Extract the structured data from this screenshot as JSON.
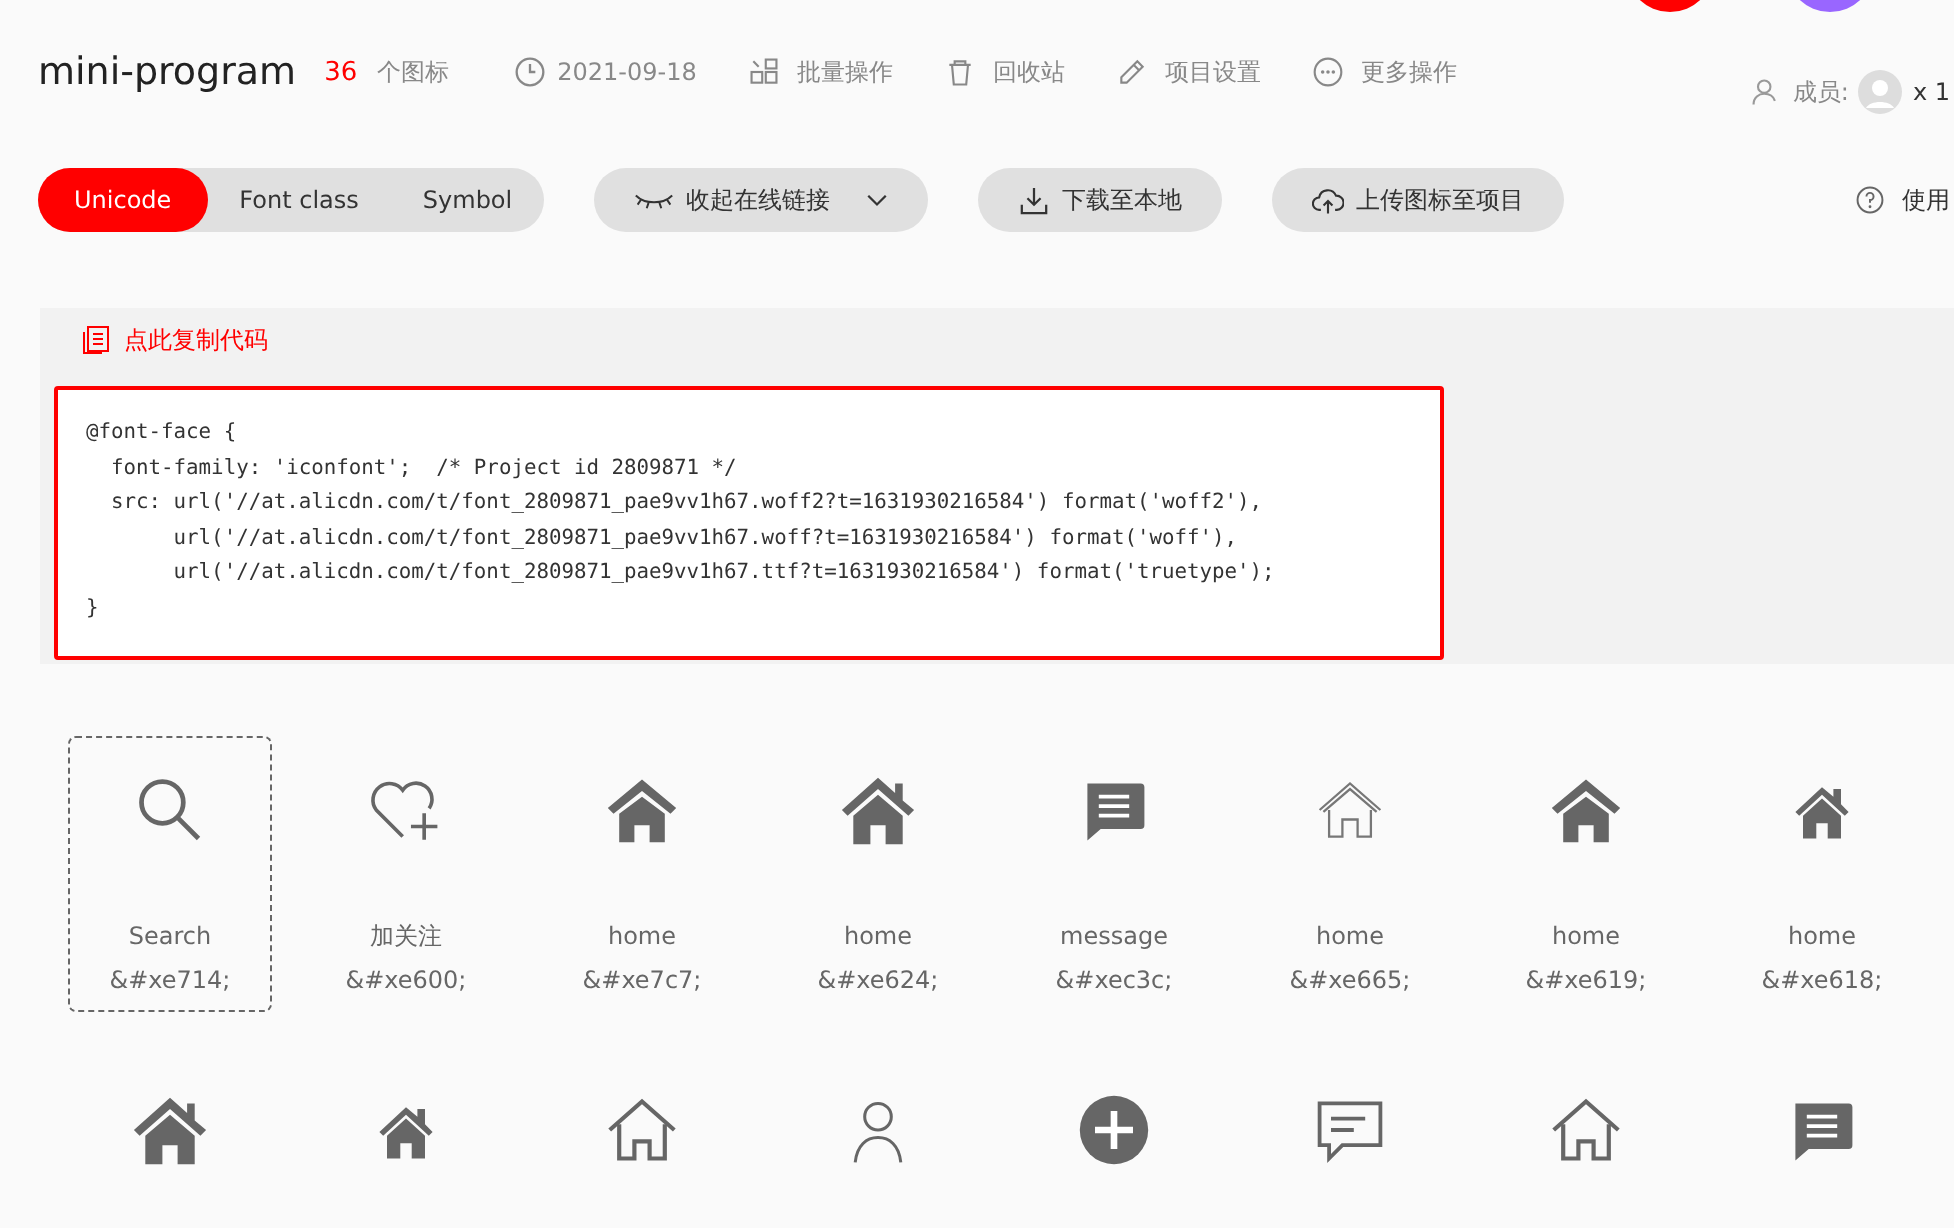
{
  "project": {
    "title": "mini-program",
    "icon_count": "36",
    "count_label": "个图标",
    "date": "2021-09-18",
    "actions": [
      {
        "kind": "batch",
        "label": "批量操作"
      },
      {
        "kind": "trash",
        "label": "回收站"
      },
      {
        "kind": "settings",
        "label": "项目设置"
      },
      {
        "kind": "more",
        "label": "更多操作"
      }
    ],
    "members_label": "成员:",
    "members_count": "x 1"
  },
  "tabs": [
    {
      "label": "Unicode",
      "selected": true
    },
    {
      "label": "Font class",
      "selected": false
    },
    {
      "label": "Symbol",
      "selected": false
    }
  ],
  "toolbar": [
    {
      "kind": "eye",
      "label": "收起在线链接",
      "caret": true
    },
    {
      "kind": "download",
      "label": "下载至本地",
      "caret": false
    },
    {
      "kind": "upload",
      "label": "上传图标至项目",
      "caret": false
    }
  ],
  "help_label": "使用",
  "copy_link": "点此复制代码",
  "code_lines": [
    "@font-face {",
    "  font-family: 'iconfont';  /* Project id 2809871 */",
    "  src: url('//at.alicdn.com/t/font_2809871_pae9vv1h67.woff2?t=1631930216584') format('woff2'),",
    "       url('//at.alicdn.com/t/font_2809871_pae9vv1h67.woff?t=1631930216584') format('woff'),",
    "       url('//at.alicdn.com/t/font_2809871_pae9vv1h67.ttf?t=1631930216584') format('truetype');",
    "}"
  ],
  "icons": [
    {
      "kind": "search",
      "name": "Search",
      "code": "&#xe714;",
      "selected": true
    },
    {
      "kind": "heart-plus",
      "name": "加关注",
      "code": "&#xe600;",
      "selected": false
    },
    {
      "kind": "home-solid",
      "name": "home",
      "code": "&#xe7c7;",
      "selected": false
    },
    {
      "kind": "home-chimney",
      "name": "home",
      "code": "&#xe624;",
      "selected": false
    },
    {
      "kind": "message",
      "name": "message",
      "code": "&#xec3c;",
      "selected": false
    },
    {
      "kind": "home-thin",
      "name": "home",
      "code": "&#xe665;",
      "selected": false
    },
    {
      "kind": "home-solid",
      "name": "home",
      "code": "&#xe619;",
      "selected": false
    },
    {
      "kind": "home-small",
      "name": "home",
      "code": "&#xe618;",
      "selected": false
    },
    {
      "kind": "home-chimney",
      "selected": false
    },
    {
      "kind": "home-small",
      "selected": false
    },
    {
      "kind": "home-outline",
      "selected": false
    },
    {
      "kind": "user",
      "selected": false
    },
    {
      "kind": "plus-circle",
      "selected": false
    },
    {
      "kind": "comment",
      "selected": false
    },
    {
      "kind": "home-outline",
      "selected": false
    },
    {
      "kind": "message",
      "selected": false
    }
  ]
}
